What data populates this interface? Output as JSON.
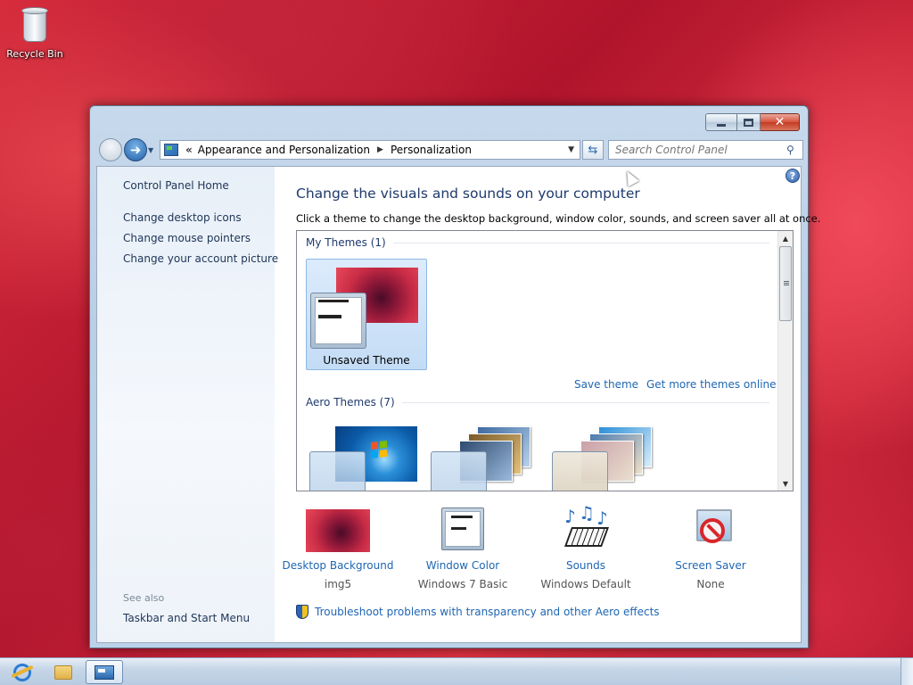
{
  "desktop": {
    "recycle_bin_label": "Recycle Bin"
  },
  "window": {
    "address": {
      "overflow": "«",
      "crumbs": [
        "Appearance and Personalization",
        "Personalization"
      ]
    },
    "search_placeholder": "Search Control Panel",
    "buttons": {
      "minimize": "minimize",
      "maximize": "maximize",
      "close": "✕"
    }
  },
  "sidebar": {
    "home": "Control Panel Home",
    "links": [
      "Change desktop icons",
      "Change mouse pointers",
      "Change your account picture"
    ],
    "see_also_header": "See also",
    "see_also_links": [
      "Taskbar and Start Menu"
    ]
  },
  "main": {
    "heading": "Change the visuals and sounds on your computer",
    "subtext": "Click a theme to change the desktop background, window color, sounds, and screen saver all at once.",
    "my_themes_header": "My Themes (1)",
    "selected_theme": "Unsaved Theme",
    "save_theme": "Save theme",
    "get_more_themes": "Get more themes online",
    "aero_themes_header": "Aero Themes (7)",
    "settings": [
      {
        "label": "Desktop Background",
        "value": "img5",
        "icon": "desktop-background-icon"
      },
      {
        "label": "Window Color",
        "value": "Windows 7 Basic",
        "icon": "window-color-icon"
      },
      {
        "label": "Sounds",
        "value": "Windows Default",
        "icon": "sounds-icon"
      },
      {
        "label": "Screen Saver",
        "value": "None",
        "icon": "screen-saver-icon"
      }
    ],
    "troubleshoot": "Troubleshoot problems with transparency and other Aero effects"
  },
  "colors": {
    "link": "#1f66b3",
    "heading": "#1e3a6d",
    "sidebar_text": "#1e3557",
    "selected_tile": "#c3dcf5",
    "close_button": "#c33b22"
  }
}
